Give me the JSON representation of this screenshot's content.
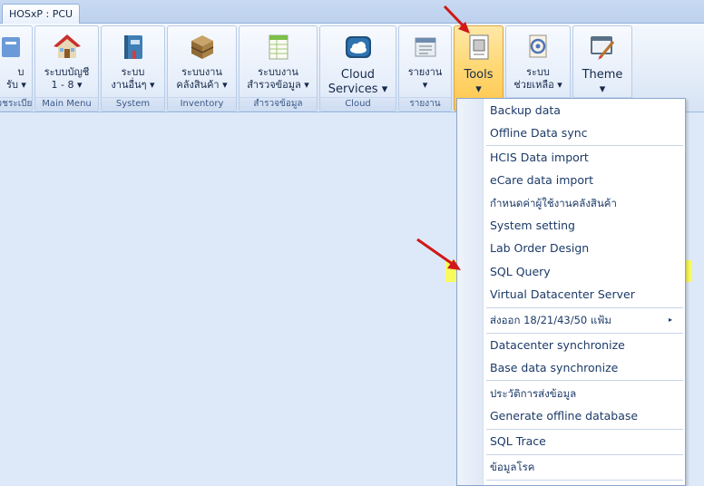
{
  "window": {
    "tab_title": "HOSxP : PCU"
  },
  "ribbon": {
    "groups": [
      {
        "id": "regist",
        "line1": "บ",
        "line2": "รับ ▾",
        "caption": "ลเวชระเบียน"
      },
      {
        "id": "account",
        "line1": "ระบบบัญชี",
        "line2": "1 - 8 ▾",
        "caption": "Main Menu"
      },
      {
        "id": "system",
        "line1": "ระบบ",
        "line2": "งานอื่นๆ ▾",
        "caption": "System"
      },
      {
        "id": "inventory",
        "line1": "ระบบงาน",
        "line2": "คลังสินค้า ▾",
        "caption": "Inventory"
      },
      {
        "id": "survey",
        "line1": "ระบบงาน",
        "line2": "สำรวจข้อมูล ▾",
        "caption": "สำรวจข้อมูล"
      },
      {
        "id": "cloud",
        "line1": "Cloud",
        "line2": "Services ▾",
        "caption": "Cloud"
      },
      {
        "id": "report",
        "line1": "รายงาน",
        "line2": "▾",
        "caption": "รายงาน"
      },
      {
        "id": "tools",
        "line1": "Tools",
        "line2": "▾",
        "caption": ""
      },
      {
        "id": "help",
        "line1": "ระบบ",
        "line2": "ช่วยเหลือ ▾",
        "caption": ""
      },
      {
        "id": "theme",
        "line1": "Theme",
        "line2": "▾",
        "caption": ""
      }
    ]
  },
  "menu": {
    "items": [
      "Backup data",
      "Offline Data sync",
      "HCIS Data import",
      "eCare data import",
      "กำหนดค่าผู้ใช้งานคลังสินค้า",
      "System setting",
      "Lab Order Design",
      "SQL Query",
      "Virtual Datacenter Server",
      "ส่งออก 18/21/43/50 แฟ้ม",
      "Datacenter synchronize",
      "Base data synchronize",
      "ประวัติการส่งข้อมูล",
      "Generate offline database",
      "SQL Trace",
      "ข้อมูลโรค"
    ],
    "highlighted": "SQL Query",
    "submenu_marker": "▸"
  },
  "colors": {
    "highlight": "#fbfb4f",
    "arrow": "#d01818",
    "tools_active": "#ffd978"
  },
  "icons": {
    "regist": "registration-icon",
    "account": "house-icon",
    "system": "book-icon",
    "inventory": "crate-icon",
    "survey": "spreadsheet-icon",
    "cloud": "cloud-icon",
    "report": "report-icon",
    "tools": "document-tool-icon",
    "help": "help-mail-icon",
    "theme": "theme-brush-icon"
  }
}
